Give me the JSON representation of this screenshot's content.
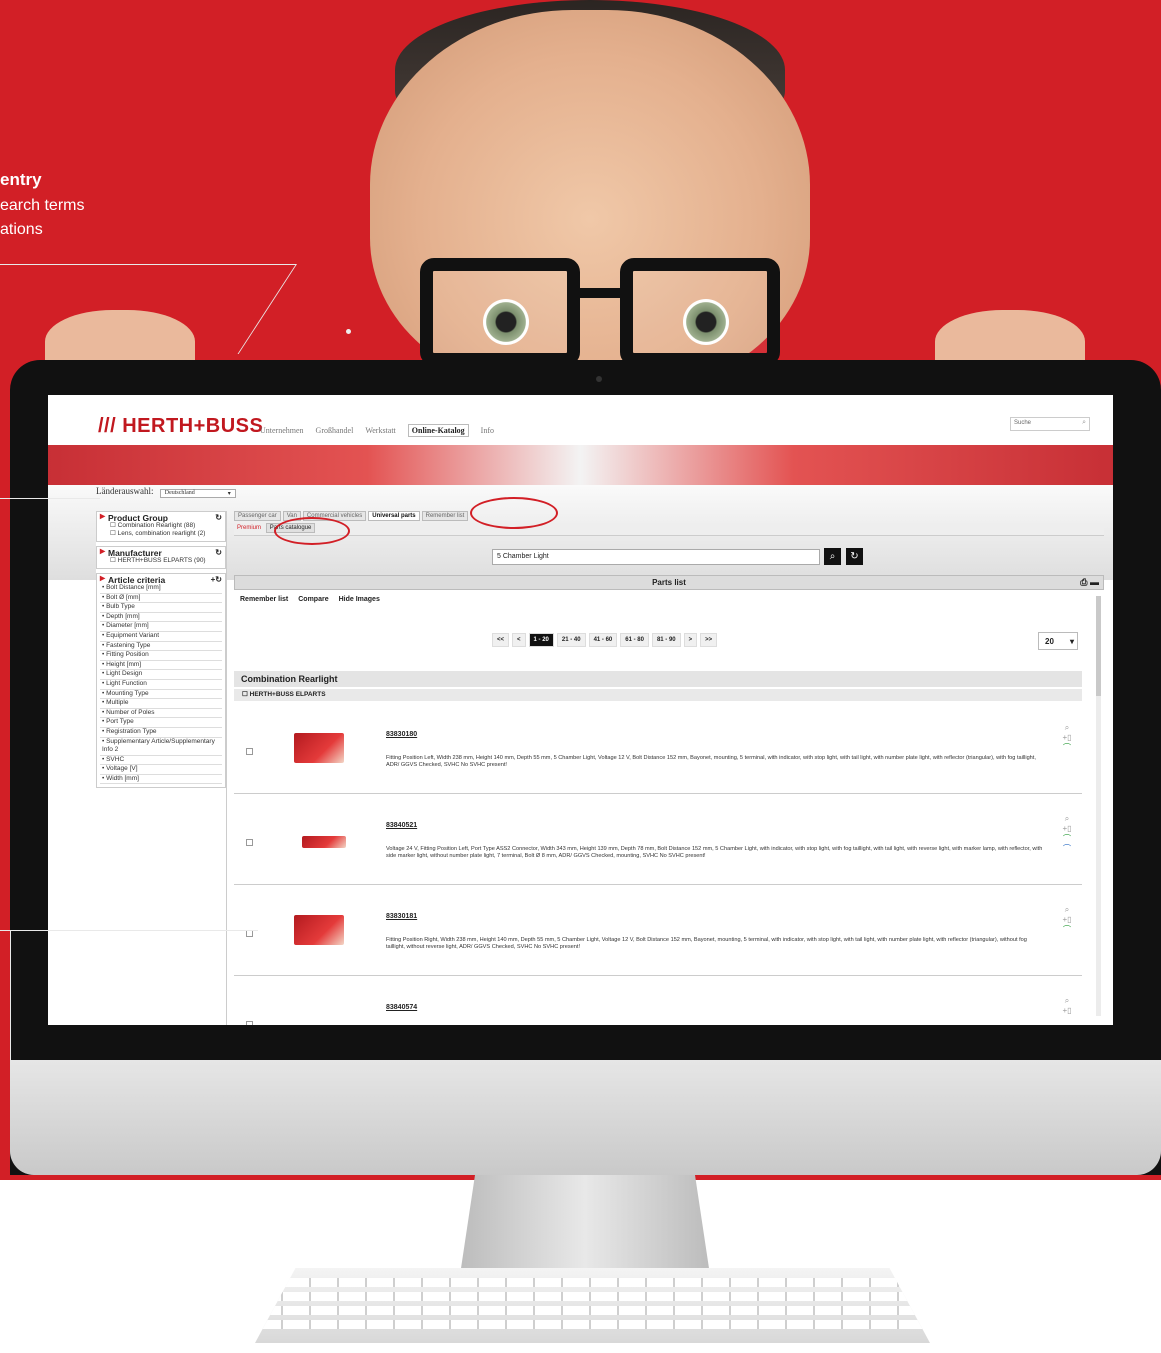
{
  "callout": {
    "title": "entry",
    "line1": "earch terms",
    "line2": "ations"
  },
  "site": {
    "logo": "/// HERTH+BUSS",
    "nav": [
      "Unternehmen",
      "Großhandel",
      "Werkstatt",
      "Online-Katalog",
      "Info"
    ],
    "search_placeholder": "Suche",
    "country_label": "Länderauswahl:",
    "country_value": "Deutschland"
  },
  "sidebar": {
    "product_group": {
      "title": "Product Group",
      "options": [
        "Combination Rearlight (88)",
        "Lens, combination rearlight (2)"
      ]
    },
    "manufacturer": {
      "title": "Manufacturer",
      "options": [
        "HERTH+BUSS ELPARTS (90)"
      ]
    },
    "criteria": {
      "title": "Article criteria",
      "items": [
        "• Bolt Distance [mm]",
        "• Bolt Ø [mm]",
        "• Bulb Type",
        "• Depth [mm]",
        "• Diameter [mm]",
        "• Equipment Variant",
        "• Fastening Type",
        "• Fitting Position",
        "• Height [mm]",
        "• Light Design",
        "• Light Function",
        "• Mounting Type",
        "• Multiple",
        "• Number of Poles",
        "• Port Type",
        "• Registration Type",
        "• Supplementary Article/Supplementary Info 2",
        "• SVHC",
        "• Voltage [V]",
        "• Width [mm]"
      ]
    }
  },
  "tabs": [
    "Passenger car",
    "Van",
    "Commercial vehicles",
    "Universal parts",
    "Remember list"
  ],
  "subtabs": [
    "Premium",
    "Parts catalogue"
  ],
  "search": {
    "query": "5 Chamber Light"
  },
  "parts_list": {
    "title": "Parts list",
    "toolbar": [
      "Remember list",
      "Compare",
      "Hide Images"
    ],
    "pager": [
      "<<",
      "<",
      "1 - 20",
      "21 - 40",
      "41 - 60",
      "61 - 80",
      "81 - 90",
      ">",
      ">>"
    ],
    "per_page": "20",
    "group": "Combination Rearlight",
    "manufacturer": "HERTH+BUSS ELPARTS"
  },
  "articles": [
    {
      "no": "83830180",
      "desc": "Fitting Position Left, Width 238 mm, Height 140 mm, Depth 55 mm, 5 Chamber Light, Voltage 12 V, Bolt Distance 152 mm, Bayonet, mounting, 5 terminal, with indicator, with stop light, with tail light, with number plate light, with reflector (triangular), with fog taillight, ADR/ GGVS Checked, SVHC No SVHC present!"
    },
    {
      "no": "83840521",
      "desc": "Voltage 24 V, Fitting Position Left, Port Type ASS2 Connector, Width 343 mm, Height 139 mm, Depth 78 mm, Bolt Distance 152 mm, 5 Chamber Light, with indicator, with stop light, with fog taillight, with tail light, with reverse light, with marker lamp, with reflector, with side marker light, without number plate light, 7 terminal, Bolt Ø 8 mm, ADR/ GGVS Checked, mounting, SVHC No SVHC present!"
    },
    {
      "no": "83830181",
      "desc": "Fitting Position Right, Width 238 mm, Height 140 mm, Depth 55 mm, 5 Chamber Light, Voltage 12 V, Bolt Distance 152 mm, Bayonet, mounting, 5 terminal, with indicator, with stop light, with tail light, with number plate light, with reflector (triangular), without fog taillight, without reverse light, ADR/ GGVS Checked, SVHC No SVHC present!"
    },
    {
      "no": "83840574",
      "desc": ""
    }
  ],
  "colors": {
    "brand_red": "#d21f26",
    "dark": "#111111"
  }
}
